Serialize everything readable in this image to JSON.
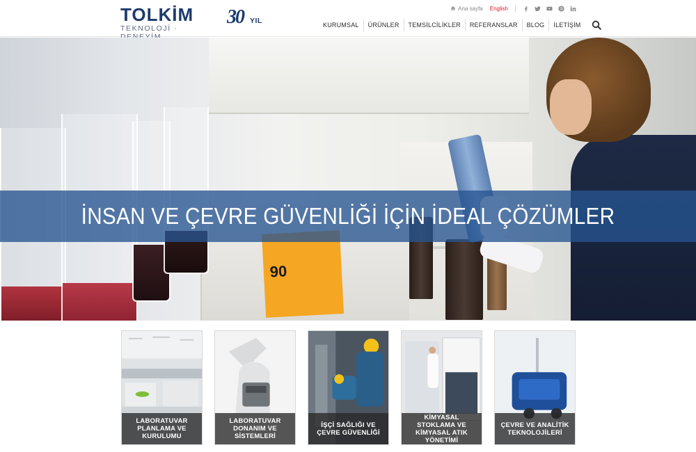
{
  "brand": {
    "logo_main": "TOLKİM",
    "logo_sub": "TEKNOLOJİ · DENEYİM",
    "anniversary_number": "30",
    "anniversary_suffix": "YIL"
  },
  "topbar": {
    "home_label": "Ana sayfa",
    "language_label": "English",
    "social_icons": [
      "facebook-icon",
      "twitter-icon",
      "youtube-icon",
      "pinterest-icon",
      "linkedin-icon"
    ]
  },
  "nav": {
    "items": [
      {
        "label": "KURUMSAL"
      },
      {
        "label": "ÜRÜNLER"
      },
      {
        "label": "TEMSİLCİLİKLER"
      },
      {
        "label": "REFERANSLAR"
      },
      {
        "label": "BLOG"
      },
      {
        "label": "İLETİŞİM"
      }
    ],
    "search_icon": "search-icon"
  },
  "hero": {
    "headline": "İNSAN VE ÇEVRE GÜVENLİĞİ İÇİN İDEAL ÇÖZÜMLER",
    "sticker_text": "90"
  },
  "categories": [
    {
      "label": "LABORATUVAR PLANLAMA VE KURULUMU"
    },
    {
      "label": "LABORATUVAR DONANIM VE SİSTEMLERİ"
    },
    {
      "label": "İŞÇİ SAĞLIĞI VE ÇEVRE GÜVENLİĞİ"
    },
    {
      "label": "KİMYASAL STOKLAMA VE KİMYASAL ATIK YÖNETİMİ"
    },
    {
      "label": "ÇEVRE VE ANALİTİK TEKNOLOJİLERİ"
    }
  ],
  "colors": {
    "brand_navy": "#1c3b6e",
    "banner_blue": "#265491",
    "language_red": "#e11b22",
    "caption_dark": "#282828"
  }
}
